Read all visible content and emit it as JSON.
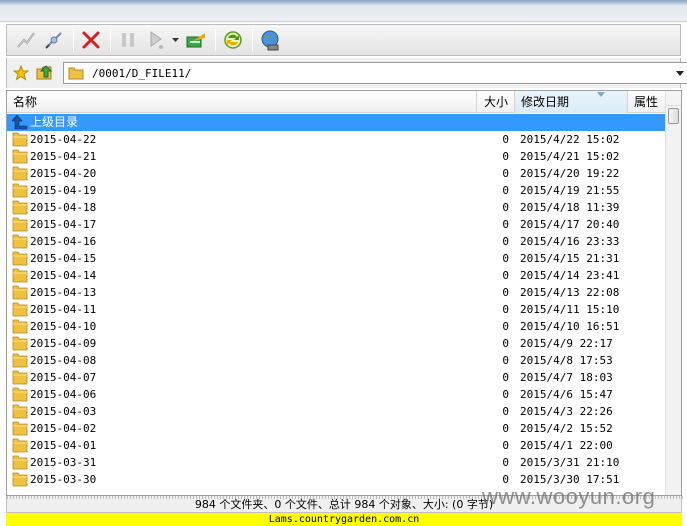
{
  "address": {
    "path": "/0001/D_FILE11/"
  },
  "columns": {
    "name": "名称",
    "size": "大小",
    "date": "修改日期",
    "attr": "属性"
  },
  "up_row": {
    "label": "上级目录"
  },
  "files": [
    {
      "name": "2015-04-22",
      "size": "0",
      "date": "2015/4/22 15:02"
    },
    {
      "name": "2015-04-21",
      "size": "0",
      "date": "2015/4/21 15:02"
    },
    {
      "name": "2015-04-20",
      "size": "0",
      "date": "2015/4/20 19:22"
    },
    {
      "name": "2015-04-19",
      "size": "0",
      "date": "2015/4/19 21:55"
    },
    {
      "name": "2015-04-18",
      "size": "0",
      "date": "2015/4/18 11:39"
    },
    {
      "name": "2015-04-17",
      "size": "0",
      "date": "2015/4/17 20:40"
    },
    {
      "name": "2015-04-16",
      "size": "0",
      "date": "2015/4/16 23:33"
    },
    {
      "name": "2015-04-15",
      "size": "0",
      "date": "2015/4/15 21:31"
    },
    {
      "name": "2015-04-14",
      "size": "0",
      "date": "2015/4/14 23:41"
    },
    {
      "name": "2015-04-13",
      "size": "0",
      "date": "2015/4/13 22:08"
    },
    {
      "name": "2015-04-11",
      "size": "0",
      "date": "2015/4/11 15:10"
    },
    {
      "name": "2015-04-10",
      "size": "0",
      "date": "2015/4/10 16:51"
    },
    {
      "name": "2015-04-09",
      "size": "0",
      "date": "2015/4/9 22:17"
    },
    {
      "name": "2015-04-08",
      "size": "0",
      "date": "2015/4/8 17:53"
    },
    {
      "name": "2015-04-07",
      "size": "0",
      "date": "2015/4/7 18:03"
    },
    {
      "name": "2015-04-06",
      "size": "0",
      "date": "2015/4/6 15:47"
    },
    {
      "name": "2015-04-03",
      "size": "0",
      "date": "2015/4/3 22:26"
    },
    {
      "name": "2015-04-02",
      "size": "0",
      "date": "2015/4/2 15:52"
    },
    {
      "name": "2015-04-01",
      "size": "0",
      "date": "2015/4/1 22:00"
    },
    {
      "name": "2015-03-31",
      "size": "0",
      "date": "2015/3/31 21:10"
    },
    {
      "name": "2015-03-30",
      "size": "0",
      "date": "2015/3/30 17:51"
    }
  ],
  "status": {
    "summary": "984 个文件夹、0 个文件、总计 984 个对象、大小: (0 字节)"
  },
  "host": {
    "text": "Lams.countrygarden.com.cn"
  },
  "watermark": {
    "text": "www.wooyun.org"
  },
  "icons": {
    "connect": "connect-icon",
    "disconnect": "disconnect-icon",
    "delete": "delete-icon",
    "pause": "pause-icon",
    "play": "play-icon",
    "transfer": "transfer-icon",
    "refresh": "refresh-icon",
    "globe": "globe-icon",
    "favorite": "star-icon",
    "open_folder": "open-folder-icon",
    "folder": "folder-icon",
    "up": "up-arrow-icon"
  },
  "colors": {
    "selection": "#3399ff",
    "host_bar": "#ffff00",
    "delete_red": "#d62020",
    "folder_yellow": "#f0c040"
  }
}
